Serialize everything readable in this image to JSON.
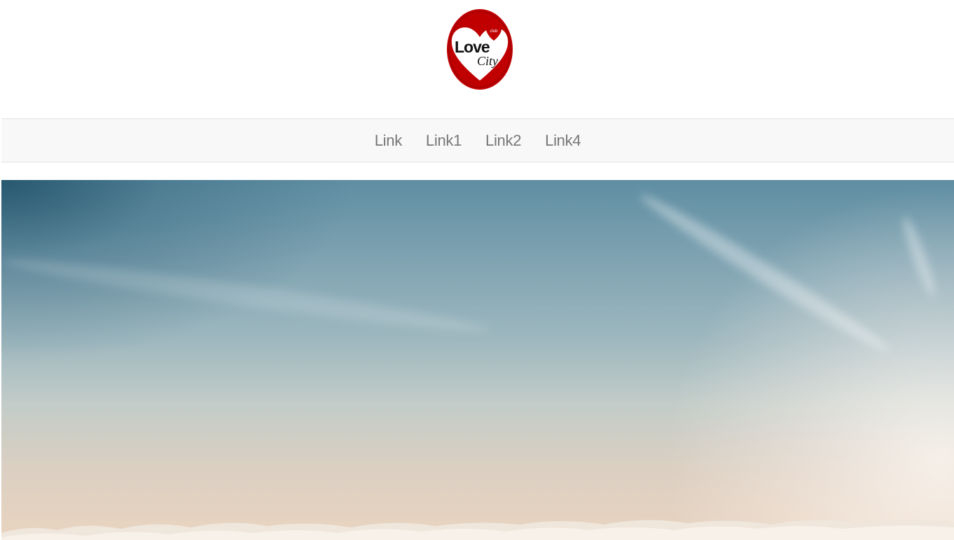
{
  "logo": {
    "brand_love": "Love",
    "brand_city": "City",
    "brand_badge": "club"
  },
  "nav": {
    "links": [
      "Link",
      "Link1",
      "Link2",
      "Link4"
    ]
  },
  "colors": {
    "logo_red": "#c00000",
    "navbar_bg": "#f8f8f8",
    "nav_text": "#777777"
  }
}
